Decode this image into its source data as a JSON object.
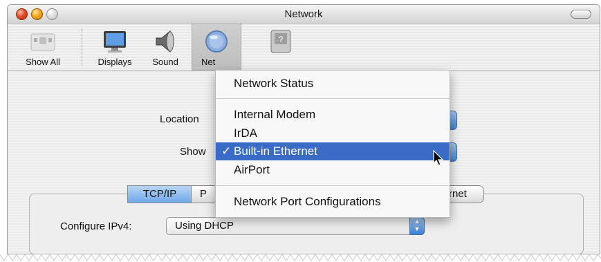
{
  "window": {
    "title": "Network"
  },
  "toolbar": {
    "items": [
      {
        "label": "Show All",
        "icon": "show-all-icon"
      },
      {
        "label": "Displays",
        "icon": "display-icon"
      },
      {
        "label": "Sound",
        "icon": "speaker-icon"
      },
      {
        "label": "Net",
        "icon": "globe-icon",
        "selected": true
      },
      {
        "label": "",
        "icon": "startup-disk-icon"
      }
    ]
  },
  "form": {
    "location_label": "Location",
    "show_label": "Show"
  },
  "tabs": [
    {
      "label": "TCP/IP",
      "active": true
    },
    {
      "label": "P",
      "active": false
    },
    {
      "label": "rnet",
      "active": false
    }
  ],
  "ipv4": {
    "label": "Configure IPv4:",
    "value": "Using DHCP"
  },
  "menu": {
    "items": [
      {
        "label": "Network Status"
      },
      {
        "label": "Internal Modem"
      },
      {
        "label": "IrDA"
      },
      {
        "label": "Built-in Ethernet",
        "selected": true,
        "check": "✓"
      },
      {
        "label": "AirPort"
      },
      {
        "label": "Network Port Configurations"
      }
    ]
  },
  "colors": {
    "selection": "#3a6bc6",
    "accent": "#3b82d8"
  }
}
